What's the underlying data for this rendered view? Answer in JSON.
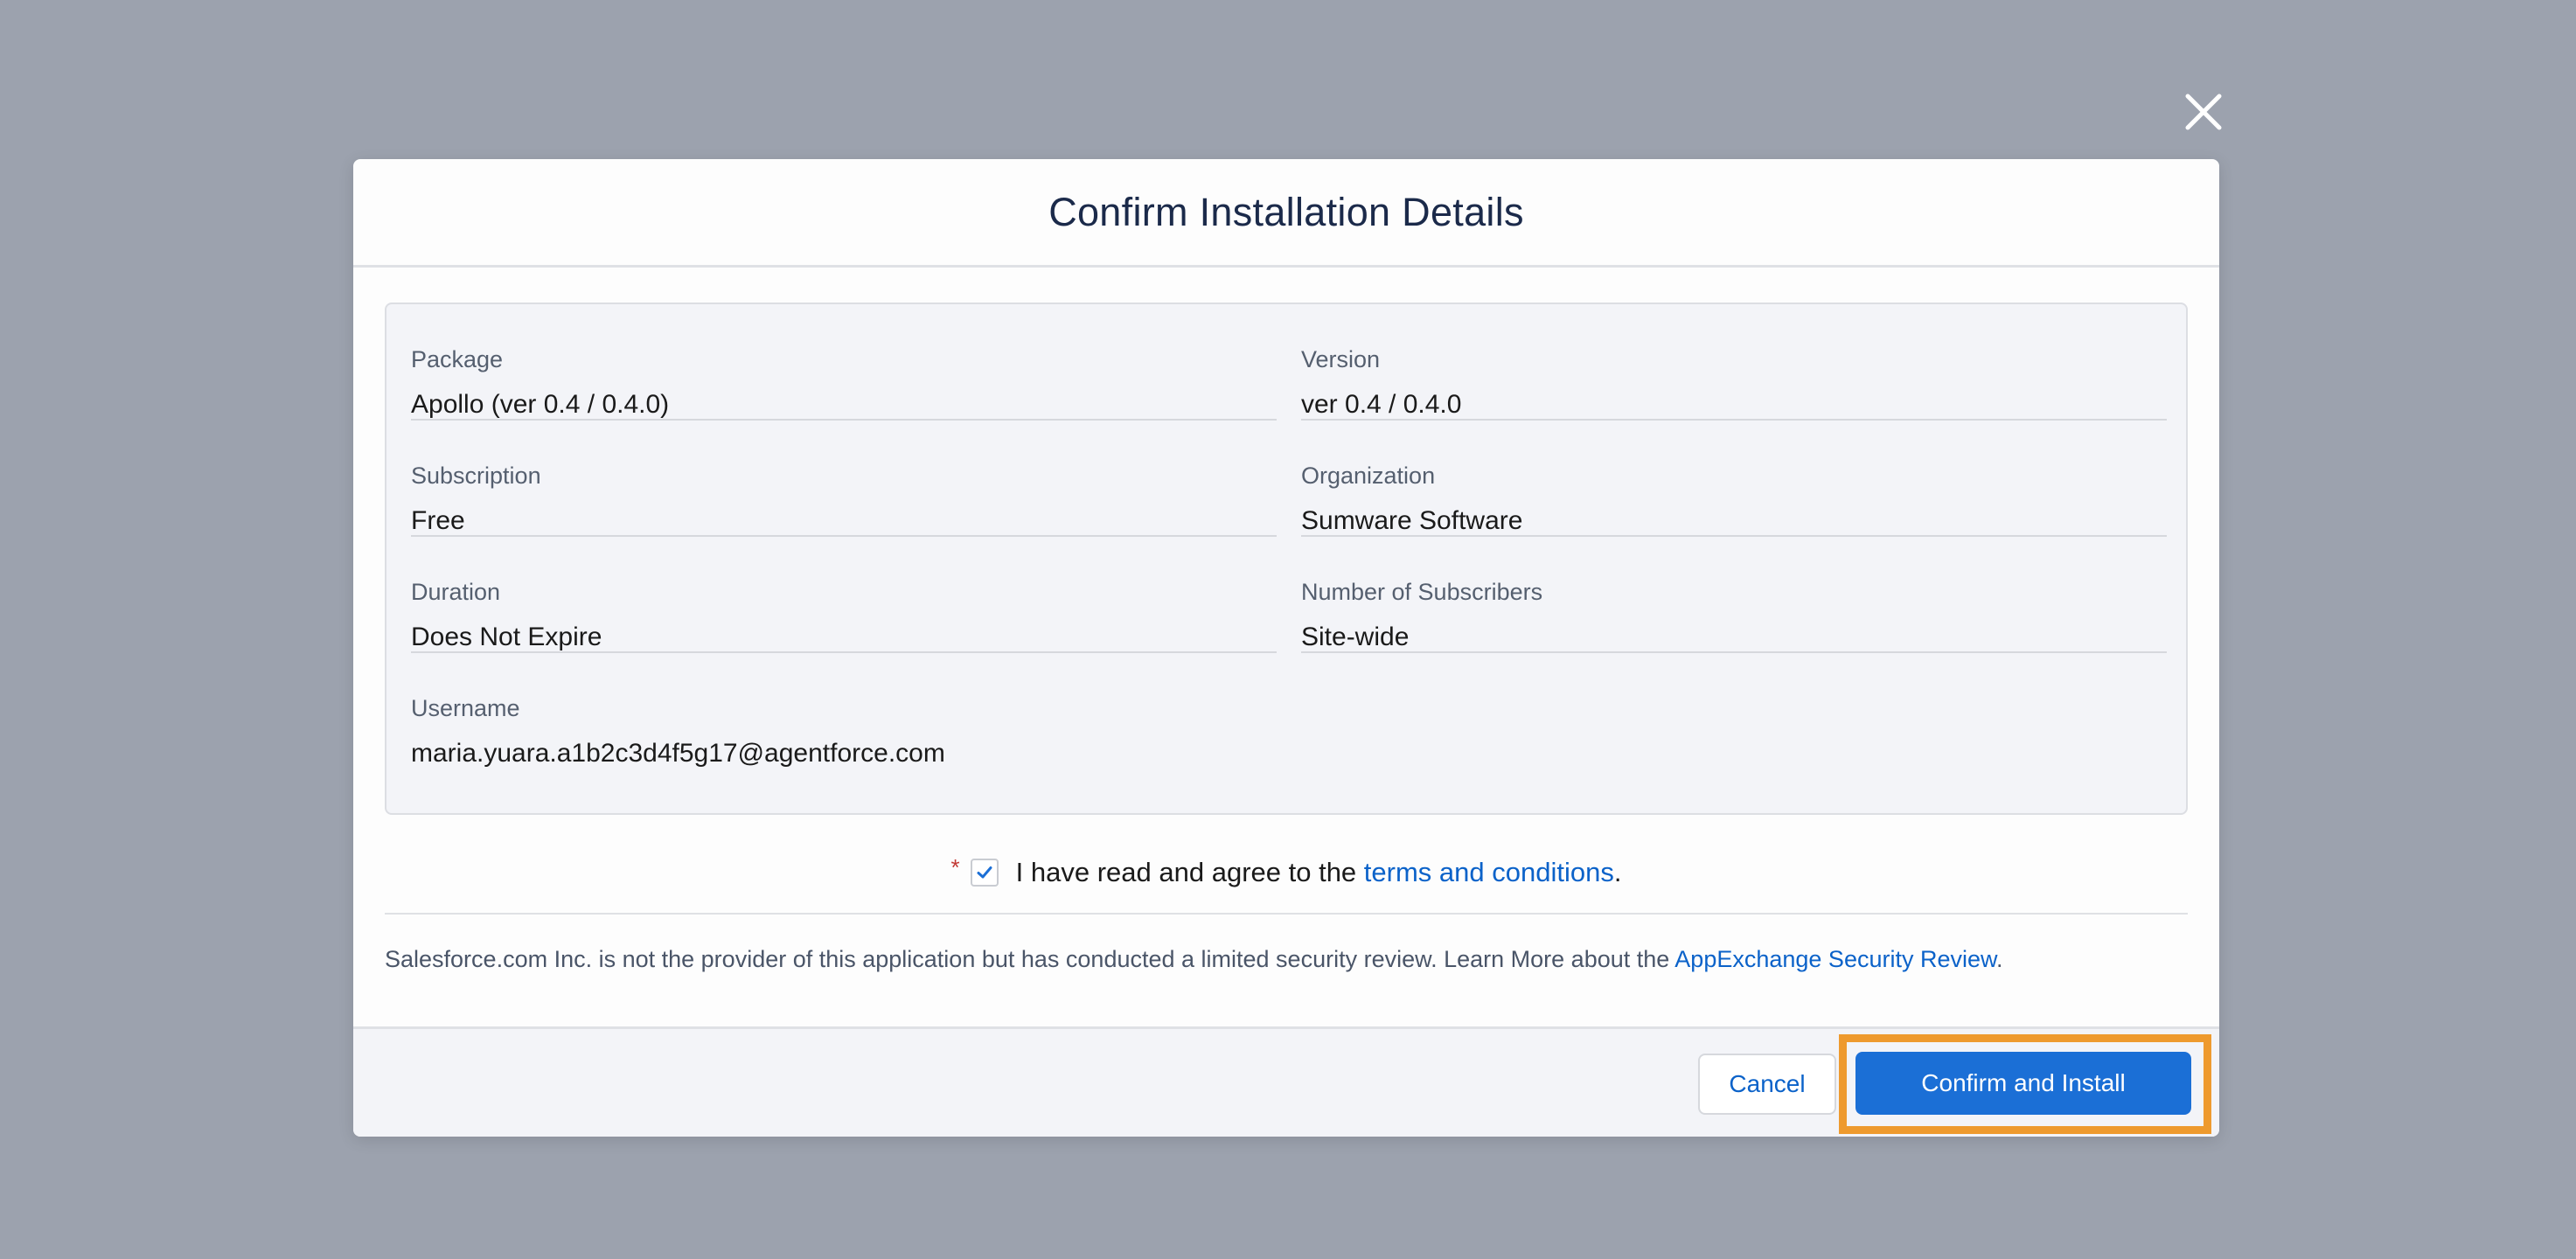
{
  "modal": {
    "title": "Confirm Installation Details",
    "close_icon": "close-icon"
  },
  "details": {
    "package": {
      "label": "Package",
      "value": "Apollo (ver 0.4 / 0.4.0)"
    },
    "version": {
      "label": "Version",
      "value": "ver 0.4 / 0.4.0"
    },
    "subscription": {
      "label": "Subscription",
      "value": "Free"
    },
    "organization": {
      "label": "Organization",
      "value": "Sumware Software"
    },
    "duration": {
      "label": "Duration",
      "value": "Does Not Expire"
    },
    "subscribers": {
      "label": "Number of Subscribers",
      "value": "Site-wide"
    },
    "username": {
      "label": "Username",
      "value": "maria.yuara.a1b2c3d4f5g17@agentforce.com"
    }
  },
  "agreement": {
    "required_marker": "*",
    "checked": true,
    "text": "I have read and agree to the ",
    "link_text": "terms and conditions",
    "suffix": "."
  },
  "disclaimer": {
    "text": "Salesforce.com Inc. is not the provider of this application but has conducted a limited security review. Learn More about the ",
    "link_text": "AppExchange Security Review",
    "suffix": "."
  },
  "footer": {
    "cancel_label": "Cancel",
    "confirm_label": "Confirm and Install"
  },
  "colors": {
    "backdrop": "#9ca2ae",
    "brand_blue": "#1b6fd6",
    "link_blue": "#0b62c9",
    "highlight_orange": "#ee9a2e",
    "required_red": "#c23934"
  }
}
